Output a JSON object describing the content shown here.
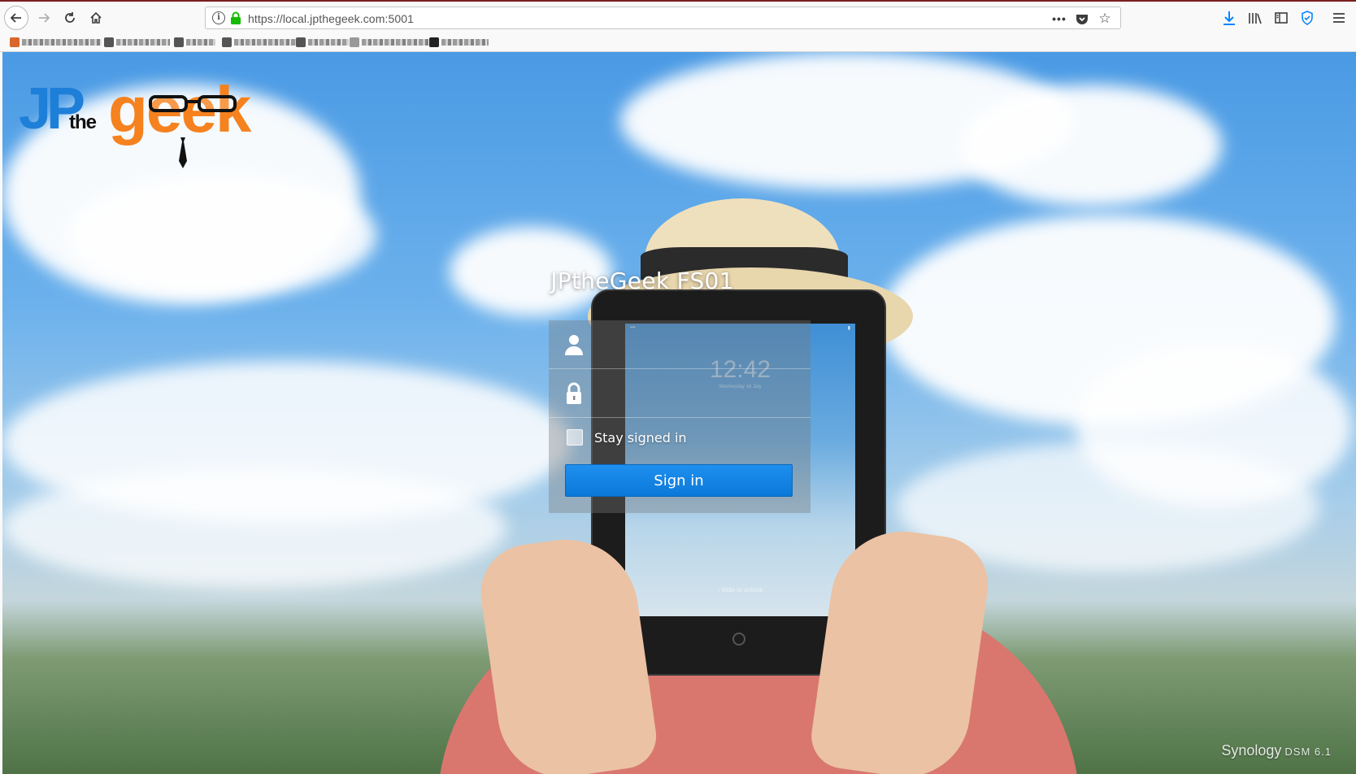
{
  "browser": {
    "url": "https://local.jpthegeek.com:5001",
    "icons": {
      "back": "back-arrow-icon",
      "forward": "forward-arrow-icon",
      "reload": "reload-icon",
      "home": "home-icon",
      "info": "info-icon",
      "lock": "lock-icon",
      "more": "more-actions-icon",
      "pocket": "pocket-icon",
      "bookmark_star": "star-icon",
      "downloads": "download-arrow-icon",
      "library": "library-icon",
      "sidebar": "sidebar-icon",
      "shield": "shield-icon",
      "menu": "hamburger-menu-icon"
    },
    "colors": {
      "accent": "#0a84ff",
      "lock_green": "#12bc00"
    }
  },
  "logo": {
    "jp": "JP",
    "the": "the",
    "geek": "geek",
    "colors": {
      "jp": "#1e7fd8",
      "geek": "#f5821f"
    }
  },
  "tablet": {
    "time": "12:42",
    "date": "Wednesday 16 July",
    "slide_text": "› slide to unlock"
  },
  "login": {
    "title": "JPtheGeek FS01",
    "username_placeholder": "",
    "password_placeholder": "",
    "stay_signed_in_label": "Stay signed in",
    "stay_signed_in_checked": false,
    "signin_label": "Sign in",
    "colors": {
      "button": "#0a79d8"
    }
  },
  "footer": {
    "brand": "Synology",
    "product": "DSM 6.1"
  }
}
